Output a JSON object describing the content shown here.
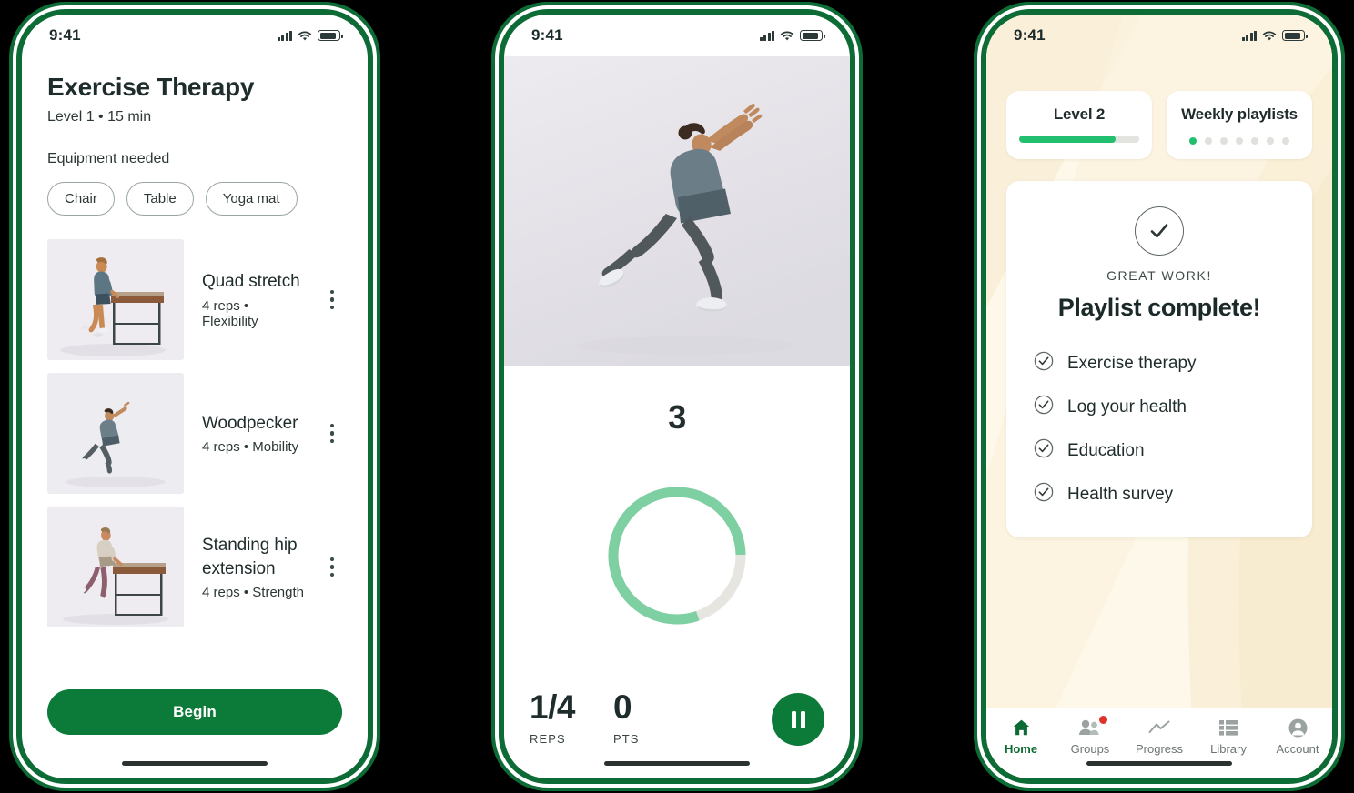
{
  "status_bar": {
    "time": "9:41",
    "icons": [
      "cellular-signal-icon",
      "wifi-icon",
      "battery-icon"
    ]
  },
  "colors": {
    "frame_green": "#0d6b35",
    "button_green": "#0c7a38",
    "accent_green": "#22c06e",
    "ring_green": "#7ecfa1",
    "ring_track": "#e7e5e0",
    "cream_bg": "#fdf7e7",
    "badge_red": "#e0312a",
    "text_dark": "#1e2c2b"
  },
  "phone1": {
    "title": "Exercise Therapy",
    "subtitle": "Level 1 • 15 min",
    "equipment_label": "Equipment needed",
    "equipment": [
      "Chair",
      "Table",
      "Yoga mat"
    ],
    "exercises": [
      {
        "name": "Quad stretch",
        "meta": "4 reps • Flexibility",
        "thumb": "man-quad-stretch-at-table-photo",
        "menu_icon": "kebab-menu-icon"
      },
      {
        "name": "Woodpecker",
        "meta": "4 reps • Mobility",
        "thumb": "woman-woodpecker-lunge-photo",
        "menu_icon": "kebab-menu-icon"
      },
      {
        "name": "Standing hip extension",
        "meta": "4 reps • Strength",
        "thumb": "woman-standing-hip-extension-at-table-photo",
        "menu_icon": "kebab-menu-icon"
      }
    ],
    "primary_button": "Begin"
  },
  "phone2": {
    "hero_photo": "woman-woodpecker-lunge-stretch-photo",
    "countdown": "3",
    "ring": {
      "progress_percent": 80,
      "fill_color": "#7ecfa1",
      "track_color": "#e7e5e0"
    },
    "stats": [
      {
        "value": "1/4",
        "label": "REPS"
      },
      {
        "value": "0",
        "label": "PTS"
      }
    ],
    "pause_button": {
      "icon": "pause-icon",
      "label": "Pause"
    }
  },
  "phone3": {
    "level_card": {
      "title": "Level 2",
      "progress_percent": 80
    },
    "playlist_card": {
      "title": "Weekly playlists",
      "dots_total": 7,
      "dots_active": 1
    },
    "completion_card": {
      "check_icon": "check-circle-icon",
      "eyebrow": "GREAT WORK!",
      "heading": "Playlist complete!",
      "tasks": [
        {
          "label": "Exercise therapy",
          "icon": "check-circle-icon",
          "done": true
        },
        {
          "label": "Log your health",
          "icon": "check-circle-icon",
          "done": true
        },
        {
          "label": "Education",
          "icon": "check-circle-icon",
          "done": true
        },
        {
          "label": "Health survey",
          "icon": "check-circle-icon",
          "done": true
        }
      ]
    },
    "tabs": [
      {
        "label": "Home",
        "icon": "home-icon",
        "active": true,
        "badge": false
      },
      {
        "label": "Groups",
        "icon": "people-icon",
        "active": false,
        "badge": true
      },
      {
        "label": "Progress",
        "icon": "line-chart-icon",
        "active": false,
        "badge": false
      },
      {
        "label": "Library",
        "icon": "list-icon",
        "active": false,
        "badge": false
      },
      {
        "label": "Account",
        "icon": "person-icon",
        "active": false,
        "badge": false
      }
    ]
  }
}
